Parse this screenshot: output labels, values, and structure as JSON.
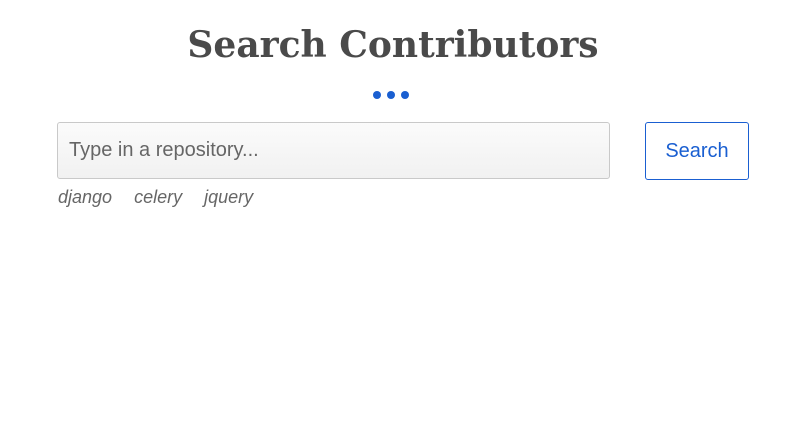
{
  "header": {
    "title": "Search Contributors"
  },
  "colors": {
    "accent": "#1a5fd1",
    "title": "#4a4a4a",
    "muted": "#666666"
  },
  "search": {
    "placeholder": "Type in a repository...",
    "value": "",
    "button_label": "Search"
  },
  "suggestions": [
    "django",
    "celery",
    "jquery"
  ]
}
